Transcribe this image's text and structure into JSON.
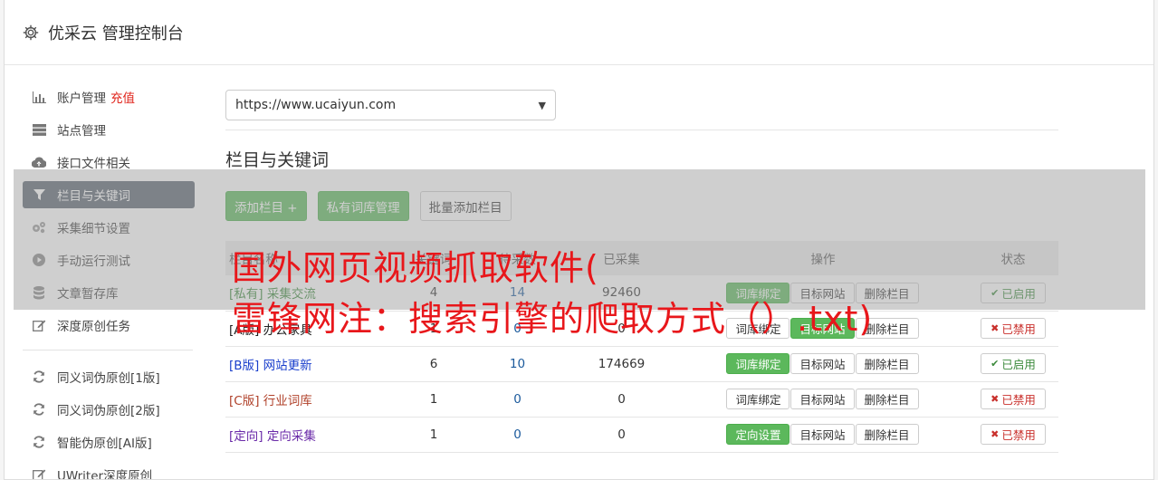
{
  "header": {
    "title": "优采云 管理控制台",
    "icon": "gear-icon"
  },
  "sidebar": {
    "items": [
      {
        "label": "账户管理",
        "hot": "充值",
        "icon": "bar-chart-icon",
        "active": false
      },
      {
        "label": "站点管理",
        "icon": "server-icon",
        "active": false
      },
      {
        "label": "接口文件相关",
        "icon": "cloud-upload-icon",
        "active": false
      },
      {
        "label": "栏目与关键词",
        "icon": "filter-icon",
        "active": true
      },
      {
        "label": "采集细节设置",
        "icon": "gears-icon",
        "active": false
      },
      {
        "label": "手动运行测试",
        "icon": "play-circle-icon",
        "active": false
      },
      {
        "label": "文章暂存库",
        "icon": "database-icon",
        "active": false
      },
      {
        "label": "深度原创任务",
        "icon": "edit-icon",
        "active": false
      }
    ],
    "items2": [
      {
        "label": "同义词伪原创[1版]",
        "icon": "refresh-icon"
      },
      {
        "label": "同义词伪原创[2版]",
        "icon": "refresh-icon"
      },
      {
        "label": "智能伪原创[AI版]",
        "icon": "refresh-icon"
      },
      {
        "label": "UWriter深度原创",
        "icon": "edit-icon"
      }
    ]
  },
  "main": {
    "site_select": "https://www.ucaiyun.com",
    "section_title": "栏目与关键词",
    "buttons": {
      "add": "添加栏目 +",
      "private_lib": "私有词库管理",
      "batch_add": "批量添加栏目"
    },
    "table": {
      "headers": [
        "栏目名称",
        "关键词",
        "待采数",
        "已采集",
        "操作",
        "状态"
      ],
      "rows": [
        {
          "tag": "[私有]",
          "name": "采集交流",
          "c1": "4",
          "c2": "14",
          "c3": "92460",
          "op1": "词库绑定",
          "op1_green": true,
          "op2": "目标网站",
          "op2_green": false,
          "op3": "删除栏目",
          "status": "已启用",
          "on": true,
          "color": "green"
        },
        {
          "tag": "[A版]",
          "name": "办公家具",
          "c1": "1",
          "c2": "0",
          "c3": "0",
          "op1": "词库绑定",
          "op1_green": false,
          "op2": "目标网站",
          "op2_green": true,
          "op3": "删除栏目",
          "status": "已禁用",
          "on": false,
          "color": "default"
        },
        {
          "tag": "[B版]",
          "name": "网站更新",
          "c1": "6",
          "c2": "10",
          "c3": "174669",
          "op1": "词库绑定",
          "op1_green": true,
          "op2": "目标网站",
          "op2_green": false,
          "op3": "删除栏目",
          "status": "已启用",
          "on": true,
          "color": "blue"
        },
        {
          "tag": "[C版]",
          "name": "行业词库",
          "c1": "1",
          "c2": "0",
          "c3": "0",
          "op1": "词库绑定",
          "op1_green": false,
          "op2": "目标网站",
          "op2_green": false,
          "op3": "删除栏目",
          "status": "已禁用",
          "on": false,
          "color": "red"
        },
        {
          "tag": "[定向]",
          "name": "定向采集",
          "c1": "1",
          "c2": "0",
          "c3": "0",
          "op1": "定向设置",
          "op1_green": true,
          "op2": "目标网站",
          "op2_green": false,
          "op3": "删除栏目",
          "status": "已禁用",
          "on": false,
          "color": "purple"
        }
      ]
    }
  },
  "watermark": {
    "line1": "国外网页视频抓取软件(",
    "line2": "雷锋网注：搜索引擎的爬取方式（）.txt)"
  }
}
